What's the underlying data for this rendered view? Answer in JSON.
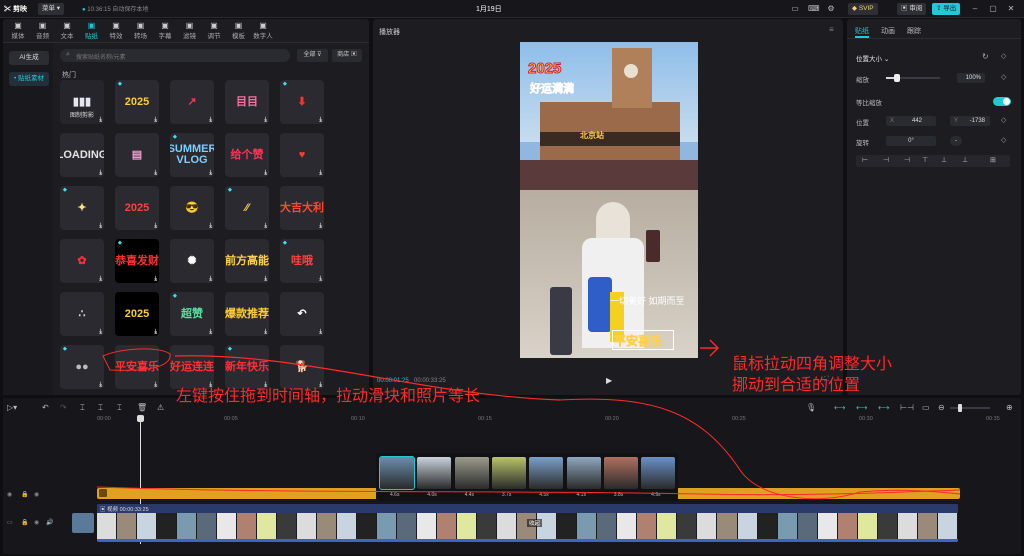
{
  "titlebar": {
    "app_name": "剪映",
    "menu_label": "菜单",
    "autosave": "10:36:15 自动保存本地",
    "project_title": "1月19日",
    "svip": "SVIP",
    "review": "审阅",
    "export": "导出"
  },
  "toolbar": {
    "tools": [
      {
        "label": "媒体",
        "icon": "media-icon"
      },
      {
        "label": "音频",
        "icon": "audio-icon"
      },
      {
        "label": "文本",
        "icon": "text-icon"
      },
      {
        "label": "贴纸",
        "icon": "sticker-icon",
        "active": true
      },
      {
        "label": "特效",
        "icon": "effects-icon"
      },
      {
        "label": "转场",
        "icon": "transition-icon"
      },
      {
        "label": "字幕",
        "icon": "caption-icon"
      },
      {
        "label": "滤镜",
        "icon": "filter-icon"
      },
      {
        "label": "调节",
        "icon": "adjust-icon"
      },
      {
        "label": "模板",
        "icon": "template-icon"
      },
      {
        "label": "数字人",
        "icon": "avatar-icon"
      }
    ]
  },
  "sidebar": {
    "items": [
      {
        "label": "AI生成"
      },
      {
        "label": "• 贴纸素材"
      }
    ]
  },
  "stickers": {
    "search_placeholder": "搜索贴纸名称/元素",
    "filter_all": "全部",
    "filter_shop": "商店",
    "section_title": "热门",
    "items": [
      {
        "text": "▮▮▮",
        "sub": "图制剪影",
        "bg": "#25252b",
        "fg": "#e7e7ef"
      },
      {
        "text": "2025",
        "bg": "#2a2a30",
        "fg": "#ffcc33"
      },
      {
        "text": "↗",
        "bg": "#2a2a30",
        "fg": "#ff3355"
      },
      {
        "text": "目目",
        "bg": "#2a2a30",
        "fg": "#ff6fa0"
      },
      {
        "text": "⬇",
        "bg": "#2a2a30",
        "fg": "#ff3030"
      },
      {
        "text": "LOADING",
        "bg": "#2a2a30",
        "fg": "#e4e4e4"
      },
      {
        "text": "▤",
        "bg": "#2a2a30",
        "fg": "#f0a0d0"
      },
      {
        "text": "SUMMER VLOG",
        "bg": "#2a2a30",
        "fg": "#7ad0ff"
      },
      {
        "text": "给个赞",
        "bg": "#2a2a30",
        "fg": "#ff3355"
      },
      {
        "text": "♥",
        "bg": "#2a2a30",
        "fg": "#ff3b30"
      },
      {
        "text": "✦",
        "bg": "#2a2a30",
        "fg": "#ffe27a"
      },
      {
        "text": "2025",
        "bg": "#2a2a30",
        "fg": "#ff4040"
      },
      {
        "text": "😎",
        "bg": "#2a2a30",
        "fg": "#ffd24a"
      },
      {
        "text": "⁄⁄",
        "bg": "#2a2a30",
        "fg": "#ffd24a"
      },
      {
        "text": "大吉大利",
        "bg": "#2a2a30",
        "fg": "#ff4a2a"
      },
      {
        "text": "✿",
        "bg": "#2a2a30",
        "fg": "#ff2a3a"
      },
      {
        "text": "恭喜发财",
        "bg": "#000000",
        "fg": "#ff3030"
      },
      {
        "text": "✺",
        "bg": "#2a2a30",
        "fg": "#ffffff"
      },
      {
        "text": "前方高能",
        "bg": "#2a2a30",
        "fg": "#ffd24a"
      },
      {
        "text": "哇哦",
        "bg": "#2a2a30",
        "fg": "#ff4040"
      },
      {
        "text": "∴",
        "bg": "#2a2a30",
        "fg": "#d0d0d0"
      },
      {
        "text": "2025",
        "bg": "#000000",
        "fg": "#ffcc33"
      },
      {
        "text": "超赞",
        "bg": "#2a2a30",
        "fg": "#57e0a0"
      },
      {
        "text": "爆款推荐",
        "bg": "#2a2a30",
        "fg": "#ffcc33"
      },
      {
        "text": "↶",
        "bg": "#2a2a30",
        "fg": "#ffffff"
      },
      {
        "text": "●●",
        "bg": "#2a2a30",
        "fg": "#bbbbbb"
      },
      {
        "text": "平安喜乐",
        "bg": "#2a2a30",
        "fg": "#ff3030"
      },
      {
        "text": "好运连连",
        "bg": "#2a2a30",
        "fg": "#ff3030"
      },
      {
        "text": "新年快乐",
        "bg": "#2a2a30",
        "fg": "#ff3030"
      },
      {
        "text": "🐕",
        "bg": "#2a2a30",
        "fg": "#f0b060"
      }
    ]
  },
  "player": {
    "title": "播放器",
    "current_time": "00:00:01:25",
    "total_time": "00:00:33:25",
    "station_sign": "北京站",
    "sticker_2025": "2025",
    "sticker_greeting": "好运满满",
    "sticker_bottom": "平安喜乐",
    "handwriting": "一切美好 如期而至"
  },
  "inspector": {
    "tabs": [
      {
        "label": "贴纸",
        "active": true
      },
      {
        "label": "动画"
      },
      {
        "label": "跟踪"
      }
    ],
    "section": "位置大小",
    "scale_label": "缩放",
    "scale_value": "100%",
    "scale_fraction": 0.2,
    "uniform_label": "等比缩放",
    "position_label": "位置",
    "pos_x_label": "X",
    "pos_x": "442",
    "pos_y_label": "Y",
    "pos_y": "-1738",
    "rotate_label": "旋转",
    "rotate_value": "0°",
    "rotate_dash": "-"
  },
  "timeline": {
    "ruler": [
      "00:00",
      "00:05",
      "00:10",
      "00:15",
      "00:20",
      "00:25",
      "00:30",
      "00:35"
    ],
    "sticker_track_label": "",
    "video_clip_label": "视频",
    "video_clip_time": "00:00:33:25",
    "frames": [
      {
        "dur": "4.6s",
        "color": "#6a8fae"
      },
      {
        "dur": "4.0s",
        "color": "#c9d3dc"
      },
      {
        "dur": "4.4s",
        "color": "#9b9c8c"
      },
      {
        "dur": "3.7s",
        "color": "#b8c46a"
      },
      {
        "dur": "4.5s",
        "color": "#7aa0c8"
      },
      {
        "dur": "4.1s",
        "color": "#8fa8c0"
      },
      {
        "dur": "3.8s",
        "color": "#b07060"
      },
      {
        "dur": "4.9s",
        "color": "#6a90c8"
      }
    ],
    "clip_tag": "收起"
  },
  "annotations": {
    "drag_hint": "左键按住拖到时间轴，拉动滑块和照片等长",
    "resize_hint_1": "鼠标拉动四角调整大小",
    "resize_hint_2": "挪动到合适的位置"
  },
  "colors": {
    "accent": "#23c8d6",
    "sticker_track": "#e0a020",
    "annotation": "#ff2a2a"
  }
}
